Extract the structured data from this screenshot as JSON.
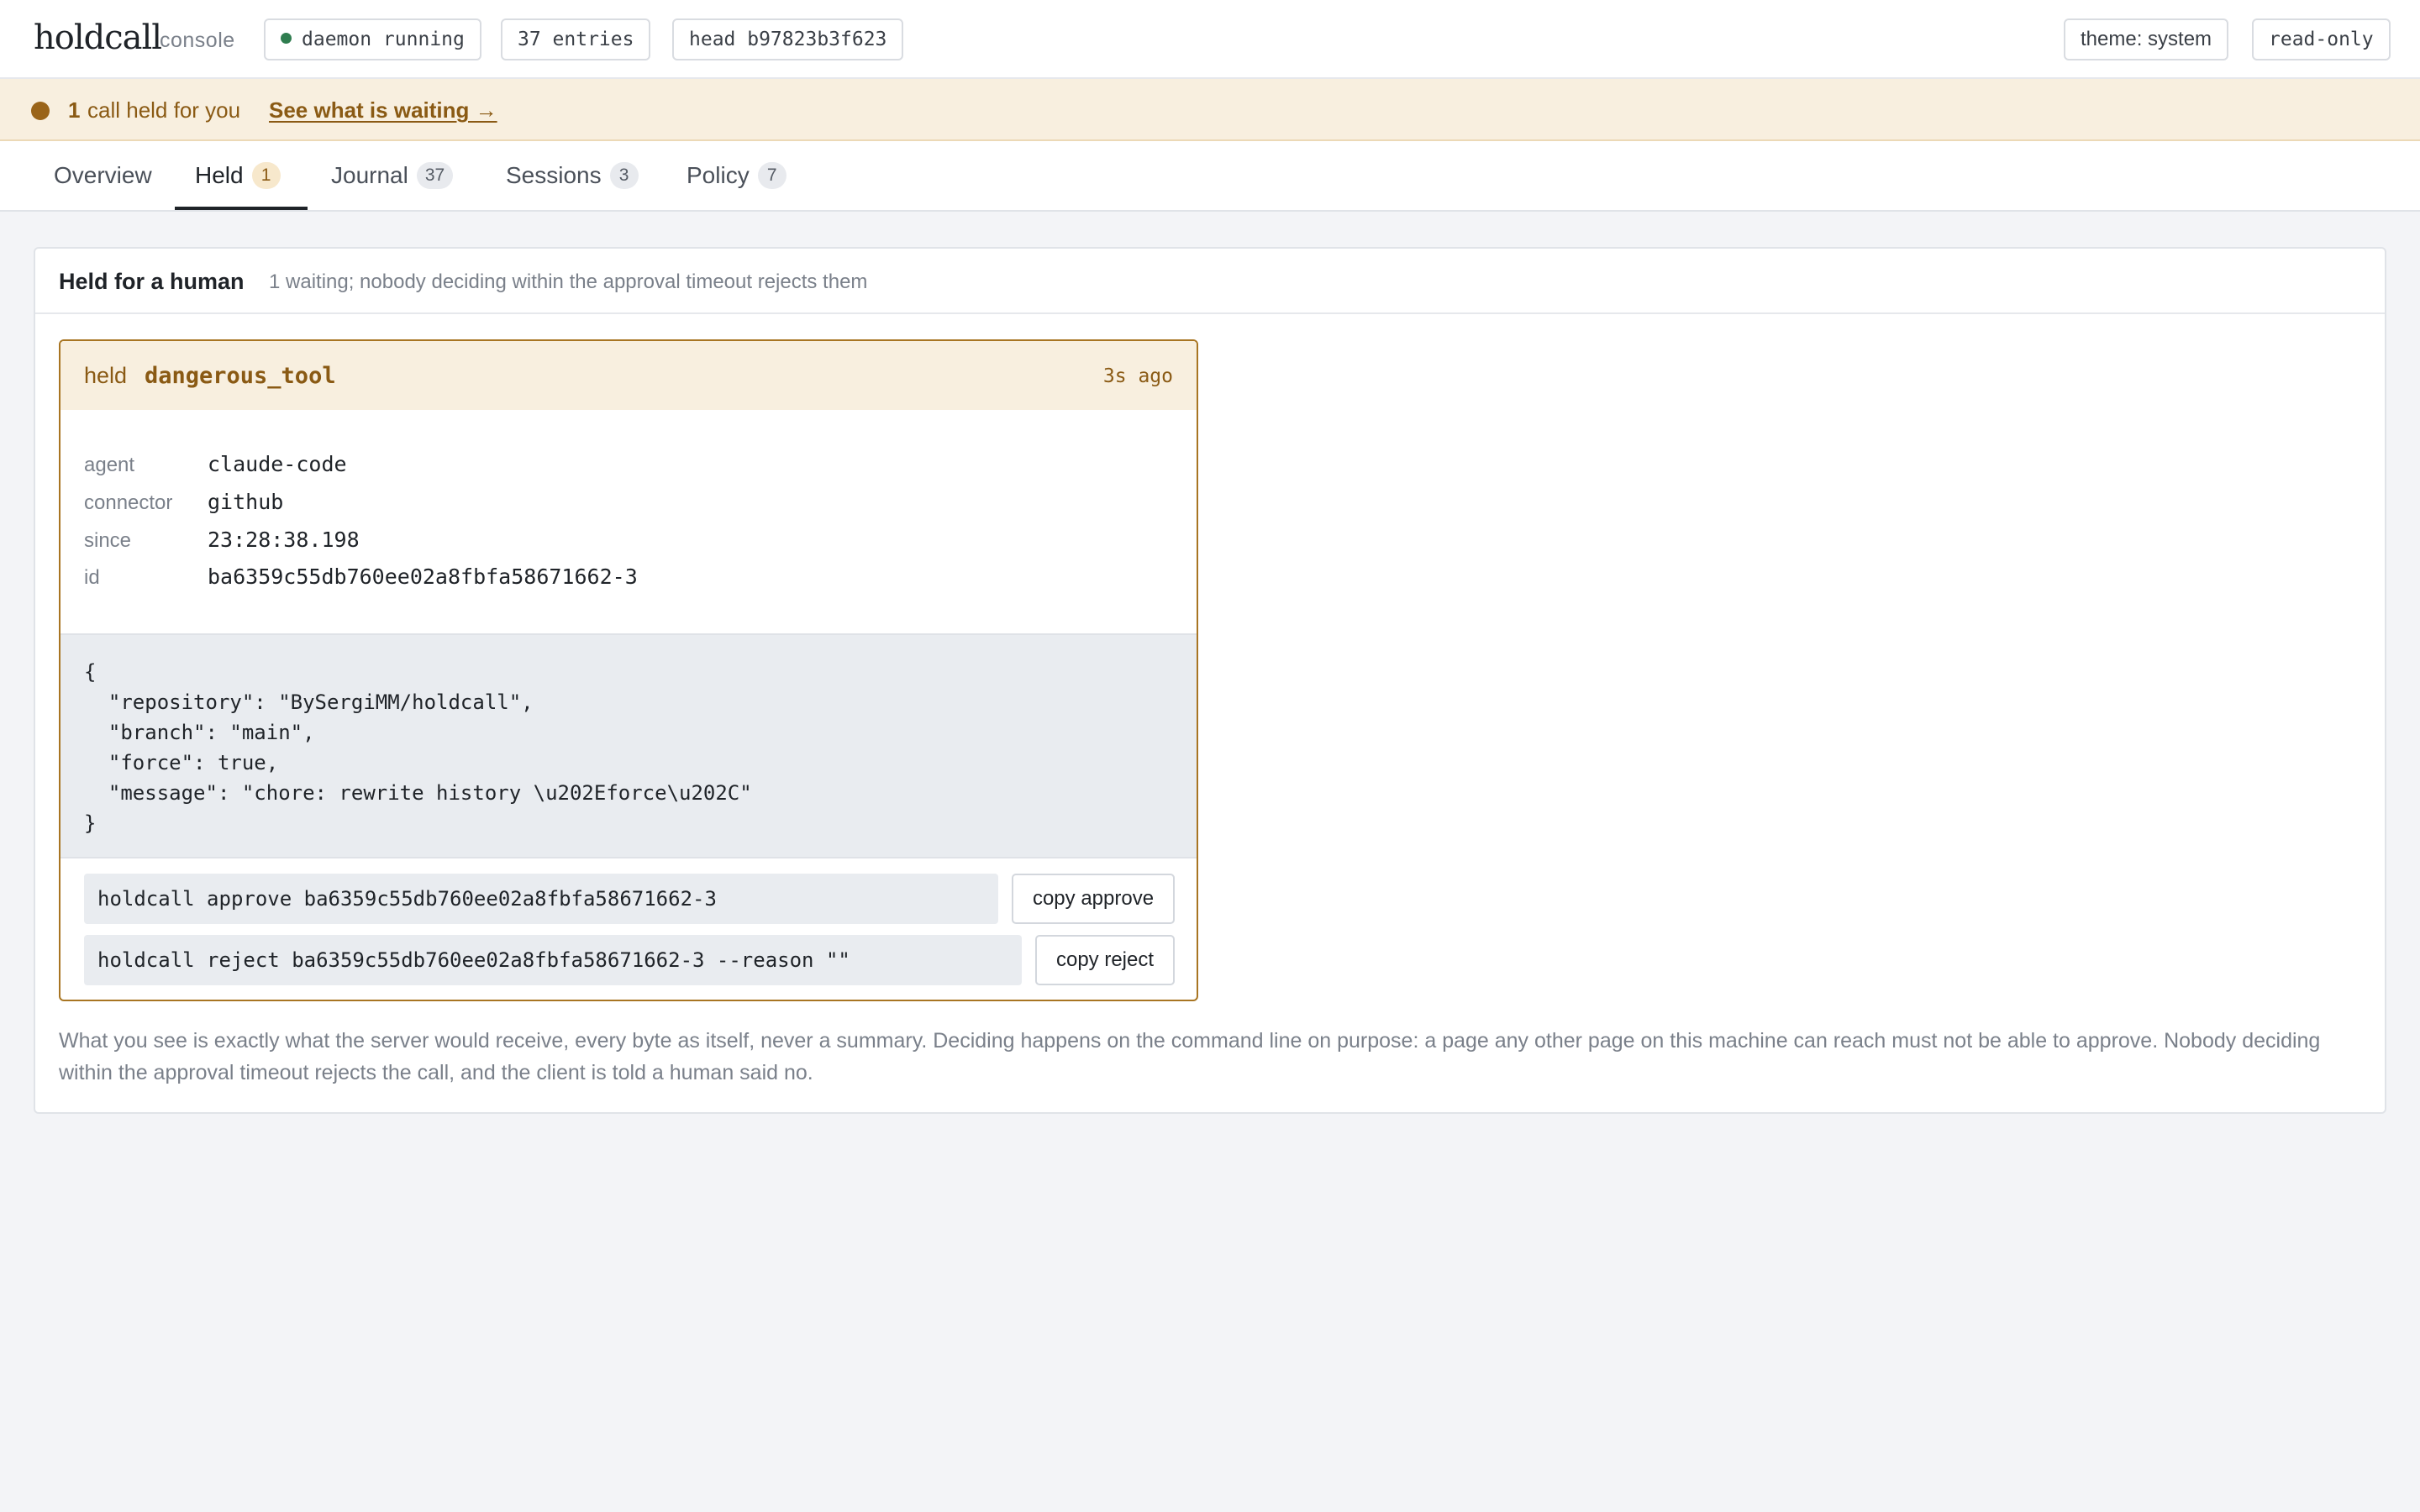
{
  "header": {
    "brand": "holdcall",
    "brand_sub": "console",
    "status_pill": "daemon running",
    "entries_pill": "37 entries",
    "head_pill": "head b97823b3f623",
    "theme_button": "theme: system",
    "mode_pill": "read-only"
  },
  "alert": {
    "count": "1",
    "text": "call held for you",
    "link": "See what is waiting →"
  },
  "tabs": [
    {
      "label": "Overview",
      "badge": ""
    },
    {
      "label": "Held",
      "badge": "1"
    },
    {
      "label": "Journal",
      "badge": "37"
    },
    {
      "label": "Sessions",
      "badge": "3"
    },
    {
      "label": "Policy",
      "badge": "7"
    }
  ],
  "active_tab": "Held",
  "panel": {
    "title": "Held for a human",
    "subtitle": "1 waiting; nobody deciding within the approval timeout rejects them"
  },
  "held_call": {
    "status": "held",
    "tool": "dangerous_tool",
    "ago": "3s ago",
    "meta": [
      {
        "key": "agent",
        "value": "claude-code"
      },
      {
        "key": "connector",
        "value": "github"
      },
      {
        "key": "since",
        "value": "23:28:38.198"
      },
      {
        "key": "id",
        "value": "ba6359c55db760ee02a8fbfa58671662-3"
      }
    ],
    "payload": "{\n  \"repository\": \"BySergiMM/holdcall\",\n  \"branch\": \"main\",\n  \"force\": true,\n  \"message\": \"chore: rewrite history \\u202Eforce\\u202C\"\n}",
    "approve_cmd": "holdcall approve ba6359c55db760ee02a8fbfa58671662-3",
    "approve_btn": "copy approve",
    "reject_cmd": "holdcall reject ba6359c55db760ee02a8fbfa58671662-3 --reason \"\"",
    "reject_btn": "copy reject"
  },
  "footnote": "What you see is exactly what the server would receive, every byte as itself, never a summary. Deciding happens on the command line on purpose: a page any other page on this machine can reach must not be able to approve. Nobody deciding within the approval timeout rejects the call, and the client is told a human said no.",
  "colors": {
    "accent": "#8a5a14",
    "alert_bg": "#f8efdf",
    "status_ok": "#2f7d4f",
    "page_bg": "#f3f4f7"
  }
}
